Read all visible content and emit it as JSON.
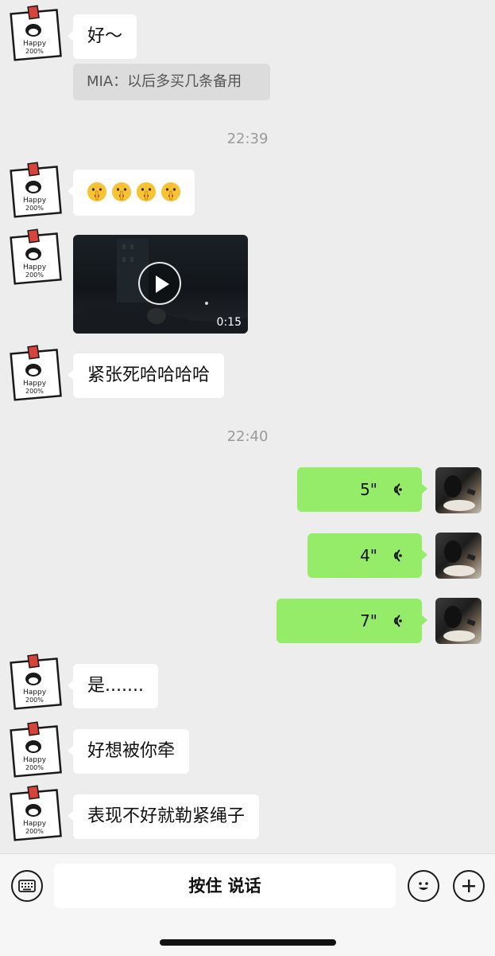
{
  "messages": {
    "m1": "好～",
    "quote": "MIA：以后多买几条备用",
    "time1": "22:39",
    "video_duration": "0:15",
    "m3": "紧张死哈哈哈哈",
    "time2": "22:40",
    "voice1": "5\"",
    "voice2": "4\"",
    "voice3": "7\"",
    "m4": "是.......",
    "m5": "好想被你牵",
    "m6": "表现不好就勒紧绳子"
  },
  "avatar_text": {
    "line1": "Happy",
    "line2": "200%"
  },
  "input_bar": {
    "hold_to_talk": "按住 说话"
  },
  "colors": {
    "background": "#ededed",
    "bubble_white": "#ffffff",
    "bubble_green": "#95ec69",
    "quote_bg": "#dcdcdc"
  },
  "icons": [
    "keyboard-icon",
    "emoji-icon",
    "plus-icon",
    "play-icon",
    "voice-wave-icon",
    "shushing-face-emoji"
  ]
}
